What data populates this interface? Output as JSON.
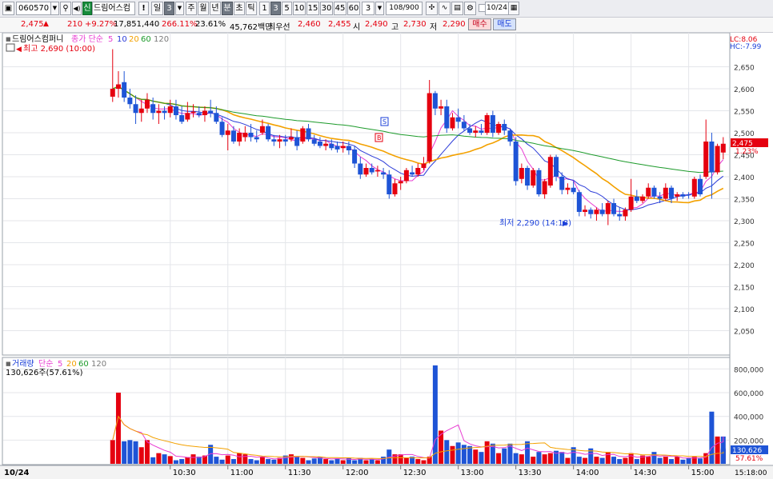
{
  "toolbar": {
    "code": "060570",
    "badge": "신",
    "name": "드림어스컴퍼",
    "alert": "!",
    "period_day": "일",
    "period_num": "3",
    "period_week": "주",
    "period_month": "월",
    "period_year": "년",
    "period_minute": "분",
    "period_second": "초",
    "period_tick": "틱",
    "intervals": [
      "1",
      "3",
      "5",
      "10",
      "15",
      "30",
      "45",
      "60"
    ],
    "interval_value": "3",
    "count": "108/900",
    "date": "10/24"
  },
  "quote": {
    "price": "2,475",
    "arrow": "▲",
    "change": "210",
    "change_pct": "+9.27%",
    "volume": "17,851,440",
    "vol_ratio": "266.11%",
    "turnover_pct": "23.61%",
    "amount": "45,762백만",
    "best_bid_label": "최우선",
    "best_bid": "2,460",
    "best_ask": "2,455",
    "open_label": "시",
    "open": "2,490",
    "high_label": "고",
    "high": "2,730",
    "low_label": "저",
    "low": "2,290",
    "buy": "매수",
    "sell": "매도"
  },
  "price_panel": {
    "title": "드림어스컴퍼니",
    "legend_label": "종가 단순",
    "ma_periods": [
      "5",
      "10",
      "20",
      "60",
      "120"
    ],
    "lc": "LC:8.06",
    "hc": "HC:-7.99",
    "max_label": "최고 2,690 (10:00)",
    "min_label": "최저 2,290 (14:18)",
    "last_price": "2,475",
    "last_pct": "1.23%",
    "signal_s": "S",
    "signal_b": "B"
  },
  "volume_panel": {
    "title": "거래량",
    "legend_label": "단순",
    "ma_periods": [
      "5",
      "20",
      "60",
      "120"
    ],
    "last_text": "130,626주(57.61%)",
    "last_value": "130,626",
    "last_pct": "57.61%"
  },
  "axis": {
    "date_label": "10/24",
    "times": [
      "10:30",
      "11:00",
      "11:30",
      "12:00",
      "12:30",
      "13:00",
      "13:30",
      "14:00",
      "14:30",
      "15:00"
    ],
    "end_time": "15:18:00"
  },
  "colors": {
    "up": "#e5000f",
    "down": "#1e54d6",
    "ma5": "#e83cd2",
    "ma10": "#2b3bd8",
    "ma20": "#f3a100",
    "ma60": "#1c9a2a",
    "ma120": "#7a7a7a"
  },
  "chart_data": [
    {
      "type": "candlestick",
      "title": "드림어스컴퍼니",
      "interval_minutes": 3,
      "y_ticks": [
        2050,
        2100,
        2150,
        2200,
        2250,
        2300,
        2350,
        2400,
        2450,
        2500,
        2550,
        2600,
        2650
      ],
      "ylim": [
        2000,
        2720
      ],
      "x_ticks": [
        "10:30",
        "11:00",
        "11:30",
        "12:00",
        "12:30",
        "13:00",
        "13:30",
        "14:00",
        "14:30",
        "15:00"
      ],
      "xlim": [
        "09:03",
        "15:21"
      ],
      "last_price": 2475,
      "annotations": [
        {
          "text": "최고 2,690 (10:00)",
          "time": "10:00",
          "value": 2690
        },
        {
          "text": "최저 2,290 (14:18)",
          "time": "14:18",
          "value": 2290
        }
      ],
      "candles": [
        {
          "t": "10:00",
          "o": 2582,
          "h": 2690,
          "l": 2570,
          "c": 2600
        },
        {
          "t": "10:03",
          "o": 2600,
          "h": 2640,
          "l": 2580,
          "c": 2610
        },
        {
          "t": "10:06",
          "o": 2615,
          "h": 2640,
          "l": 2570,
          "c": 2580
        },
        {
          "t": "10:09",
          "o": 2580,
          "h": 2600,
          "l": 2555,
          "c": 2565
        },
        {
          "t": "10:12",
          "o": 2565,
          "h": 2585,
          "l": 2520,
          "c": 2545
        },
        {
          "t": "10:15",
          "o": 2545,
          "h": 2575,
          "l": 2525,
          "c": 2555
        },
        {
          "t": "10:18",
          "o": 2555,
          "h": 2590,
          "l": 2545,
          "c": 2575
        },
        {
          "t": "10:21",
          "o": 2565,
          "h": 2580,
          "l": 2530,
          "c": 2545
        },
        {
          "t": "10:24",
          "o": 2545,
          "h": 2565,
          "l": 2520,
          "c": 2550
        },
        {
          "t": "10:27",
          "o": 2550,
          "h": 2560,
          "l": 2530,
          "c": 2545
        },
        {
          "t": "10:30",
          "o": 2545,
          "h": 2575,
          "l": 2535,
          "c": 2560
        },
        {
          "t": "10:33",
          "o": 2560,
          "h": 2575,
          "l": 2530,
          "c": 2540
        },
        {
          "t": "10:36",
          "o": 2540,
          "h": 2560,
          "l": 2520,
          "c": 2525
        },
        {
          "t": "10:39",
          "o": 2530,
          "h": 2570,
          "l": 2525,
          "c": 2545
        },
        {
          "t": "10:42",
          "o": 2545,
          "h": 2565,
          "l": 2535,
          "c": 2548
        },
        {
          "t": "10:45",
          "o": 2545,
          "h": 2560,
          "l": 2535,
          "c": 2540
        },
        {
          "t": "10:48",
          "o": 2540,
          "h": 2560,
          "l": 2525,
          "c": 2550
        },
        {
          "t": "10:51",
          "o": 2550,
          "h": 2575,
          "l": 2535,
          "c": 2545
        },
        {
          "t": "10:54",
          "o": 2545,
          "h": 2560,
          "l": 2520,
          "c": 2525
        },
        {
          "t": "10:57",
          "o": 2525,
          "h": 2535,
          "l": 2490,
          "c": 2495
        },
        {
          "t": "11:00",
          "o": 2495,
          "h": 2520,
          "l": 2460,
          "c": 2505
        },
        {
          "t": "11:03",
          "o": 2505,
          "h": 2515,
          "l": 2475,
          "c": 2480
        },
        {
          "t": "11:06",
          "o": 2480,
          "h": 2510,
          "l": 2470,
          "c": 2500
        },
        {
          "t": "11:09",
          "o": 2490,
          "h": 2515,
          "l": 2480,
          "c": 2500
        },
        {
          "t": "11:12",
          "o": 2500,
          "h": 2520,
          "l": 2480,
          "c": 2490
        },
        {
          "t": "11:15",
          "o": 2490,
          "h": 2505,
          "l": 2478,
          "c": 2485
        },
        {
          "t": "11:18",
          "o": 2500,
          "h": 2530,
          "l": 2495,
          "c": 2515
        },
        {
          "t": "11:21",
          "o": 2515,
          "h": 2520,
          "l": 2480,
          "c": 2485
        },
        {
          "t": "11:24",
          "o": 2485,
          "h": 2495,
          "l": 2470,
          "c": 2480
        },
        {
          "t": "11:27",
          "o": 2480,
          "h": 2495,
          "l": 2465,
          "c": 2485
        },
        {
          "t": "11:30",
          "o": 2485,
          "h": 2495,
          "l": 2470,
          "c": 2480
        },
        {
          "t": "11:33",
          "o": 2485,
          "h": 2510,
          "l": 2480,
          "c": 2490
        },
        {
          "t": "11:36",
          "o": 2490,
          "h": 2505,
          "l": 2460,
          "c": 2470
        },
        {
          "t": "11:39",
          "o": 2480,
          "h": 2515,
          "l": 2475,
          "c": 2510
        },
        {
          "t": "11:42",
          "o": 2510,
          "h": 2520,
          "l": 2480,
          "c": 2485
        },
        {
          "t": "11:45",
          "o": 2485,
          "h": 2495,
          "l": 2470,
          "c": 2475
        },
        {
          "t": "11:48",
          "o": 2480,
          "h": 2490,
          "l": 2465,
          "c": 2470
        },
        {
          "t": "11:51",
          "o": 2470,
          "h": 2485,
          "l": 2460,
          "c": 2475
        },
        {
          "t": "11:54",
          "o": 2475,
          "h": 2485,
          "l": 2460,
          "c": 2465
        },
        {
          "t": "11:57",
          "o": 2470,
          "h": 2480,
          "l": 2455,
          "c": 2462
        },
        {
          "t": "12:00",
          "o": 2465,
          "h": 2480,
          "l": 2455,
          "c": 2470
        },
        {
          "t": "12:03",
          "o": 2470,
          "h": 2480,
          "l": 2450,
          "c": 2460
        },
        {
          "t": "12:06",
          "o": 2462,
          "h": 2470,
          "l": 2420,
          "c": 2430
        },
        {
          "t": "12:09",
          "o": 2430,
          "h": 2445,
          "l": 2395,
          "c": 2405
        },
        {
          "t": "12:12",
          "o": 2405,
          "h": 2430,
          "l": 2400,
          "c": 2420
        },
        {
          "t": "12:15",
          "o": 2420,
          "h": 2430,
          "l": 2405,
          "c": 2410
        },
        {
          "t": "12:18",
          "o": 2412,
          "h": 2425,
          "l": 2400,
          "c": 2415
        },
        {
          "t": "12:21",
          "o": 2410,
          "h": 2420,
          "l": 2395,
          "c": 2405
        },
        {
          "t": "12:24",
          "o": 2405,
          "h": 2415,
          "l": 2350,
          "c": 2360
        },
        {
          "t": "12:27",
          "o": 2360,
          "h": 2395,
          "l": 2355,
          "c": 2385
        },
        {
          "t": "12:30",
          "o": 2385,
          "h": 2400,
          "l": 2370,
          "c": 2390
        },
        {
          "t": "12:33",
          "o": 2390,
          "h": 2420,
          "l": 2385,
          "c": 2415
        },
        {
          "t": "12:36",
          "o": 2410,
          "h": 2425,
          "l": 2400,
          "c": 2405
        },
        {
          "t": "12:39",
          "o": 2405,
          "h": 2430,
          "l": 2400,
          "c": 2420
        },
        {
          "t": "12:42",
          "o": 2420,
          "h": 2445,
          "l": 2415,
          "c": 2430
        },
        {
          "t": "12:45",
          "o": 2435,
          "h": 2620,
          "l": 2430,
          "c": 2590
        },
        {
          "t": "12:48",
          "o": 2590,
          "h": 2595,
          "l": 2540,
          "c": 2555
        },
        {
          "t": "12:51",
          "o": 2555,
          "h": 2575,
          "l": 2540,
          "c": 2560
        },
        {
          "t": "12:54",
          "o": 2560,
          "h": 2575,
          "l": 2500,
          "c": 2510
        },
        {
          "t": "12:57",
          "o": 2510,
          "h": 2545,
          "l": 2505,
          "c": 2535
        },
        {
          "t": "13:00",
          "o": 2535,
          "h": 2555,
          "l": 2510,
          "c": 2525
        },
        {
          "t": "13:03",
          "o": 2525,
          "h": 2540,
          "l": 2505,
          "c": 2510
        },
        {
          "t": "13:06",
          "o": 2510,
          "h": 2520,
          "l": 2495,
          "c": 2500
        },
        {
          "t": "13:09",
          "o": 2500,
          "h": 2515,
          "l": 2490,
          "c": 2505
        },
        {
          "t": "13:12",
          "o": 2505,
          "h": 2520,
          "l": 2495,
          "c": 2500
        },
        {
          "t": "13:15",
          "o": 2500,
          "h": 2545,
          "l": 2495,
          "c": 2540
        },
        {
          "t": "13:18",
          "o": 2540,
          "h": 2550,
          "l": 2490,
          "c": 2500
        },
        {
          "t": "13:21",
          "o": 2500,
          "h": 2525,
          "l": 2495,
          "c": 2520
        },
        {
          "t": "13:24",
          "o": 2520,
          "h": 2530,
          "l": 2495,
          "c": 2505
        },
        {
          "t": "13:27",
          "o": 2505,
          "h": 2510,
          "l": 2470,
          "c": 2480
        },
        {
          "t": "13:30",
          "o": 2480,
          "h": 2490,
          "l": 2380,
          "c": 2390
        },
        {
          "t": "13:33",
          "o": 2395,
          "h": 2430,
          "l": 2385,
          "c": 2420
        },
        {
          "t": "13:36",
          "o": 2420,
          "h": 2425,
          "l": 2370,
          "c": 2380
        },
        {
          "t": "13:39",
          "o": 2380,
          "h": 2420,
          "l": 2375,
          "c": 2415
        },
        {
          "t": "13:42",
          "o": 2415,
          "h": 2420,
          "l": 2355,
          "c": 2360
        },
        {
          "t": "13:45",
          "o": 2360,
          "h": 2395,
          "l": 2350,
          "c": 2390
        },
        {
          "t": "13:48",
          "o": 2380,
          "h": 2450,
          "l": 2375,
          "c": 2445
        },
        {
          "t": "13:51",
          "o": 2445,
          "h": 2450,
          "l": 2390,
          "c": 2400
        },
        {
          "t": "13:54",
          "o": 2400,
          "h": 2410,
          "l": 2360,
          "c": 2370
        },
        {
          "t": "13:57",
          "o": 2370,
          "h": 2385,
          "l": 2360,
          "c": 2375
        },
        {
          "t": "14:00",
          "o": 2375,
          "h": 2390,
          "l": 2360,
          "c": 2365
        },
        {
          "t": "14:03",
          "o": 2365,
          "h": 2370,
          "l": 2310,
          "c": 2320
        },
        {
          "t": "14:06",
          "o": 2320,
          "h": 2335,
          "l": 2310,
          "c": 2325
        },
        {
          "t": "14:09",
          "o": 2325,
          "h": 2330,
          "l": 2305,
          "c": 2315
        },
        {
          "t": "14:12",
          "o": 2315,
          "h": 2330,
          "l": 2300,
          "c": 2325
        },
        {
          "t": "14:15",
          "o": 2325,
          "h": 2340,
          "l": 2310,
          "c": 2315
        },
        {
          "t": "14:18",
          "o": 2315,
          "h": 2345,
          "l": 2290,
          "c": 2340
        },
        {
          "t": "14:21",
          "o": 2340,
          "h": 2350,
          "l": 2310,
          "c": 2315
        },
        {
          "t": "14:24",
          "o": 2315,
          "h": 2330,
          "l": 2300,
          "c": 2310
        },
        {
          "t": "14:27",
          "o": 2310,
          "h": 2330,
          "l": 2300,
          "c": 2325
        },
        {
          "t": "14:30",
          "o": 2325,
          "h": 2395,
          "l": 2320,
          "c": 2355
        },
        {
          "t": "14:33",
          "o": 2355,
          "h": 2370,
          "l": 2340,
          "c": 2345
        },
        {
          "t": "14:36",
          "o": 2345,
          "h": 2360,
          "l": 2340,
          "c": 2355
        },
        {
          "t": "14:39",
          "o": 2355,
          "h": 2385,
          "l": 2350,
          "c": 2375
        },
        {
          "t": "14:42",
          "o": 2375,
          "h": 2380,
          "l": 2350,
          "c": 2355
        },
        {
          "t": "14:45",
          "o": 2355,
          "h": 2365,
          "l": 2340,
          "c": 2350
        },
        {
          "t": "14:48",
          "o": 2350,
          "h": 2385,
          "l": 2345,
          "c": 2375
        },
        {
          "t": "14:51",
          "o": 2375,
          "h": 2380,
          "l": 2340,
          "c": 2350
        },
        {
          "t": "14:54",
          "o": 2355,
          "h": 2365,
          "l": 2345,
          "c": 2360
        },
        {
          "t": "14:57",
          "o": 2360,
          "h": 2365,
          "l": 2350,
          "c": 2355
        },
        {
          "t": "15:00",
          "o": 2360,
          "h": 2365,
          "l": 2350,
          "c": 2358
        },
        {
          "t": "15:03",
          "o": 2355,
          "h": 2400,
          "l": 2350,
          "c": 2395
        },
        {
          "t": "15:06",
          "o": 2395,
          "h": 2405,
          "l": 2355,
          "c": 2360
        },
        {
          "t": "15:09",
          "o": 2400,
          "h": 2530,
          "l": 2395,
          "c": 2480
        },
        {
          "t": "15:12",
          "o": 2480,
          "h": 2500,
          "l": 2350,
          "c": 2410
        },
        {
          "t": "15:15",
          "o": 2410,
          "h": 2475,
          "l": 2405,
          "c": 2470
        },
        {
          "t": "15:18",
          "o": 2455,
          "h": 2490,
          "l": 2440,
          "c": 2475
        }
      ]
    },
    {
      "type": "bar",
      "title": "거래량",
      "y_ticks": [
        200000,
        400000,
        600000,
        800000
      ],
      "ylim": [
        0,
        870000
      ],
      "last_value": 130626,
      "volumes": [
        200000,
        600000,
        190000,
        200000,
        190000,
        140000,
        200000,
        55000,
        90000,
        80000,
        65000,
        30000,
        40000,
        55000,
        80000,
        60000,
        70000,
        160000,
        60000,
        35000,
        70000,
        40000,
        90000,
        80000,
        40000,
        30000,
        60000,
        40000,
        35000,
        50000,
        70000,
        80000,
        60000,
        50000,
        30000,
        45000,
        60000,
        40000,
        30000,
        45000,
        30000,
        50000,
        30000,
        50000,
        30000,
        40000,
        30000,
        60000,
        120000,
        80000,
        80000,
        50000,
        60000,
        40000,
        30000,
        60000,
        830000,
        280000,
        200000,
        150000,
        180000,
        160000,
        150000,
        120000,
        100000,
        190000,
        170000,
        90000,
        130000,
        170000,
        90000,
        80000,
        190000,
        60000,
        100000,
        80000,
        90000,
        110000,
        100000,
        50000,
        140000,
        60000,
        50000,
        130000,
        60000,
        50000,
        100000,
        60000,
        40000,
        50000,
        90000,
        40000,
        70000,
        60000,
        100000,
        50000,
        60000,
        40000,
        60000,
        35000,
        50000,
        60000,
        45000,
        90000,
        440000,
        230000,
        120000,
        230000,
        130626
      ]
    }
  ]
}
